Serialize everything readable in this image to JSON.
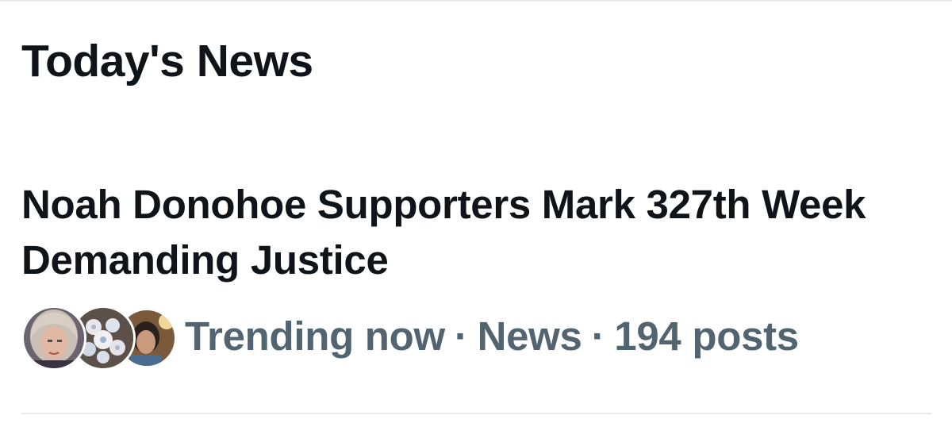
{
  "section": {
    "title": "Today's News"
  },
  "trend": {
    "headline": "Noah Donohoe Supporters Mark 327th Week Demanding Justice",
    "meta": {
      "status": "Trending now",
      "category": "News",
      "posts": "194 posts",
      "separator": "·"
    },
    "avatars": [
      {
        "icon": "avatar-woman-blonde"
      },
      {
        "icon": "avatar-floral-decor"
      },
      {
        "icon": "avatar-person-dark"
      }
    ]
  },
  "colors": {
    "primary_text": "#0f1419",
    "secondary_text": "#536471",
    "divider": "#e7e9ea",
    "background": "#ffffff"
  }
}
